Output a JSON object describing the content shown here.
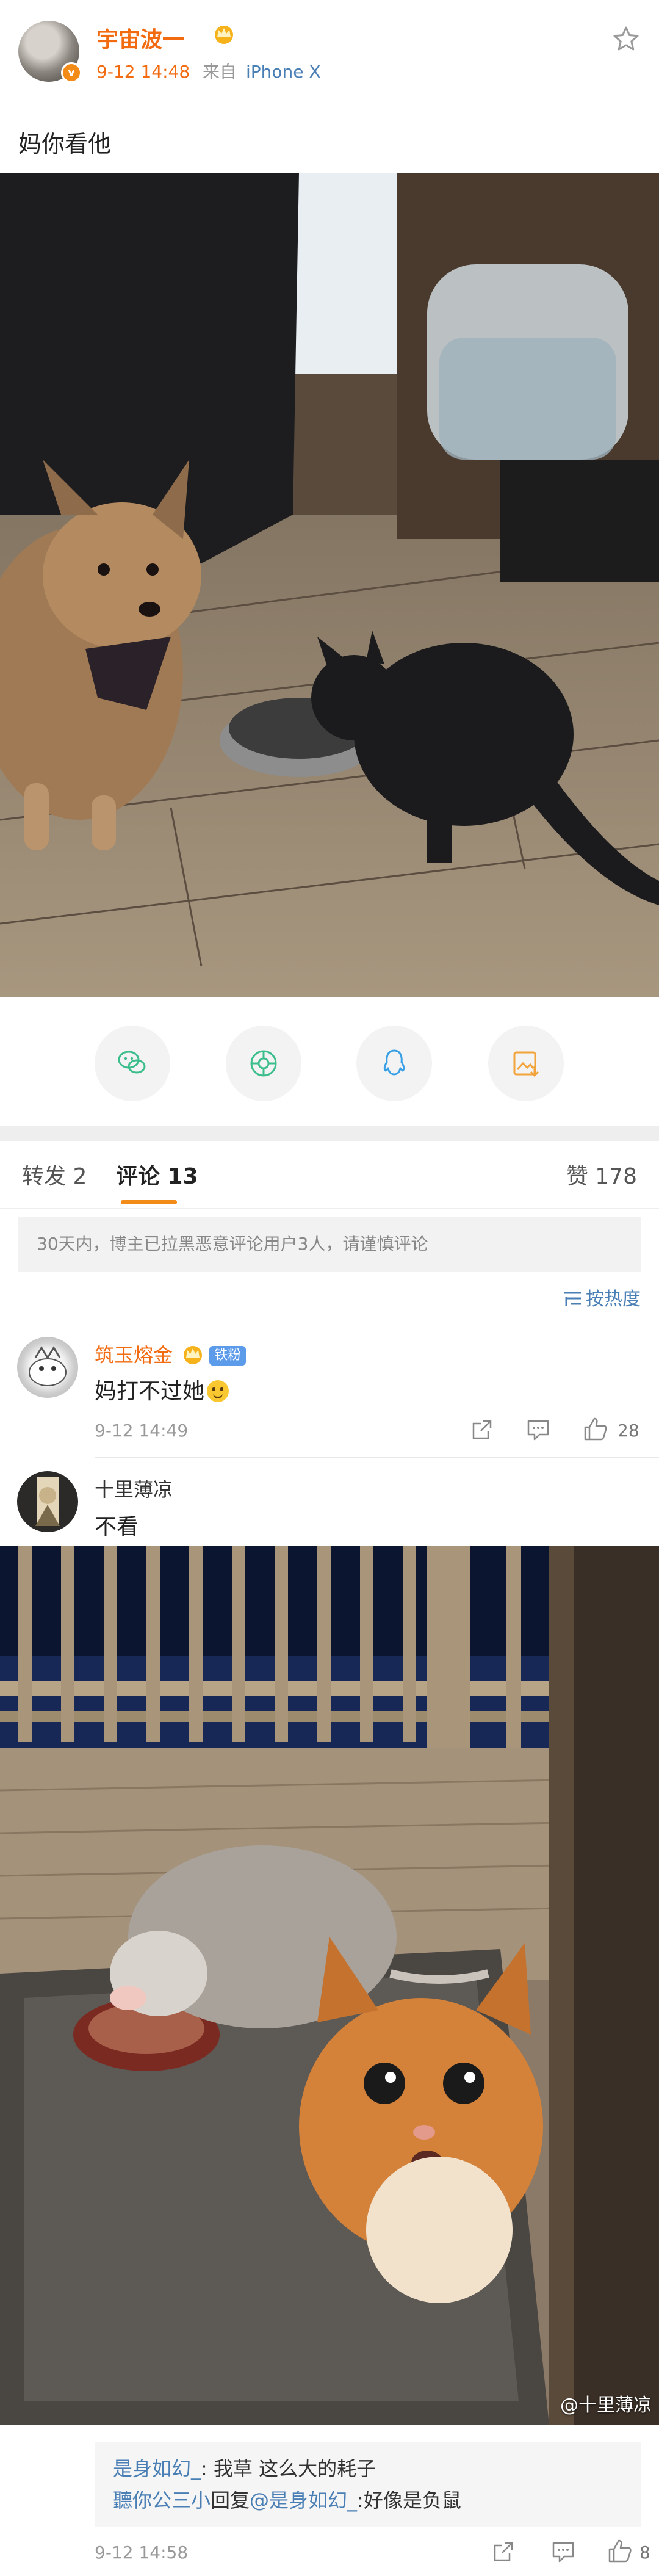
{
  "post": {
    "author_name": "宇宙波一",
    "verified_badge": "v",
    "time": "9-12 14:48",
    "source_prefix": "来自",
    "device": "iPhone X",
    "text": "妈你看他",
    "icons": {
      "favorite": "star-icon",
      "member": "crown-icon"
    }
  },
  "share": {
    "icons": [
      "wechat-icon",
      "moments-icon",
      "qq-icon",
      "save-image-icon"
    ]
  },
  "tabs": {
    "repost_label": "转发 2",
    "comment_label": "评论 13",
    "like_label": "赞 178"
  },
  "notice": "30天内，博主已拉黑恶意评论用户3人，请谨慎评论",
  "sort_label": "按热度",
  "comments": [
    {
      "name": "筑玉熔金",
      "badge": "铁粉",
      "text": "妈打不过她",
      "time": "9-12 14:49",
      "likes": "28"
    },
    {
      "name": "十里薄凉",
      "text": "不看",
      "watermark": "@十里薄凉",
      "time": "9-12 14:58",
      "likes": "8",
      "replies": [
        {
          "user": "是身如幻_",
          "text": ": 我草 这么大的耗子"
        },
        {
          "user": "聽你公三小",
          "mid": "回复",
          "target": "@是身如幻_",
          "text": ":好像是负鼠"
        }
      ]
    }
  ],
  "colors": {
    "accent": "#f26b11",
    "link": "#4a7fb5",
    "tab_underline": "#f28b18"
  }
}
